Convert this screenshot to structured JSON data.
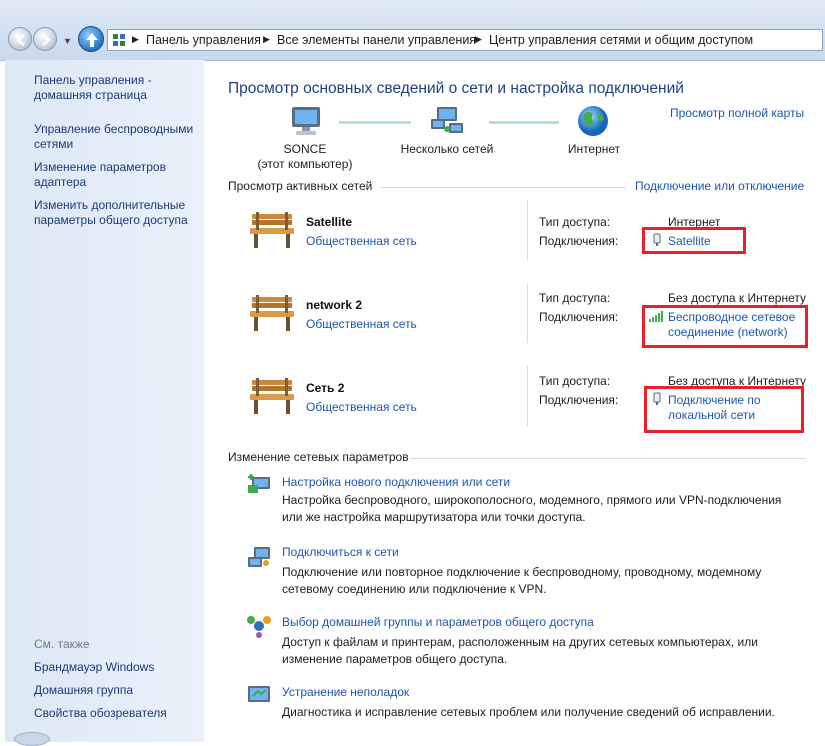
{
  "address_bar": {
    "breadcrumbs": [
      "Панель управления",
      "Все элементы панели управления",
      "Центр управления сетями и общим доступом"
    ]
  },
  "sidebar": {
    "items": [
      {
        "label": "Панель управления - домашняя страница"
      },
      {
        "label": "Управление беспроводными сетями"
      },
      {
        "label": "Изменение параметров адаптера"
      },
      {
        "label": "Изменить дополнительные параметры общего доступа"
      }
    ],
    "see_also_label": "См. также",
    "see_also": [
      {
        "label": "Брандмауэр Windows"
      },
      {
        "label": "Домашняя группа"
      },
      {
        "label": "Свойства обозревателя"
      }
    ]
  },
  "main": {
    "title": "Просмотр основных сведений о сети и настройка подключений",
    "full_map_link": "Просмотр полной карты",
    "map": {
      "computer_name": "SONCE",
      "computer_caption": "(этот компьютер)",
      "middle": "Несколько сетей",
      "internet": "Интернет"
    },
    "active_header": "Просмотр активных сетей",
    "connect_link": "Подключение или отключение",
    "access_label": "Тип доступа:",
    "connections_label": "Подключения:",
    "networks": [
      {
        "name": "Satellite",
        "type": "Общественная сеть",
        "access": "Интернет",
        "connection": "Satellite"
      },
      {
        "name": "network  2",
        "type": "Общественная сеть",
        "access": "Без доступа к Интернету",
        "connection": "Беспроводное сетевое соединение (network)"
      },
      {
        "name": "Сеть  2",
        "type": "Общественная сеть",
        "access": "Без доступа к Интернету",
        "connection": "Подключение по локальной сети"
      }
    ],
    "settings_header": "Изменение сетевых параметров",
    "tasks": [
      {
        "title": "Настройка нового подключения или сети",
        "desc": "Настройка беспроводного, широкополосного, модемного, прямого или VPN-подключения или же настройка маршрутизатора или точки доступа."
      },
      {
        "title": "Подключиться к сети",
        "desc": "Подключение или повторное подключение к беспроводному, проводному, модемному сетевому соединению или подключение к VPN."
      },
      {
        "title": "Выбор домашней группы и параметров общего доступа",
        "desc": "Доступ к файлам и принтерам, расположенным на других сетевых компьютерах, или изменение параметров общего доступа."
      },
      {
        "title": "Устранение неполадок",
        "desc": "Диагностика и исправление сетевых проблем или получение сведений об исправлении."
      }
    ]
  },
  "colors": {
    "link": "#1d56b2",
    "title": "#1f3f86",
    "highlight_box": "#e8202a",
    "sidebar_bg": "#dde8f6"
  }
}
